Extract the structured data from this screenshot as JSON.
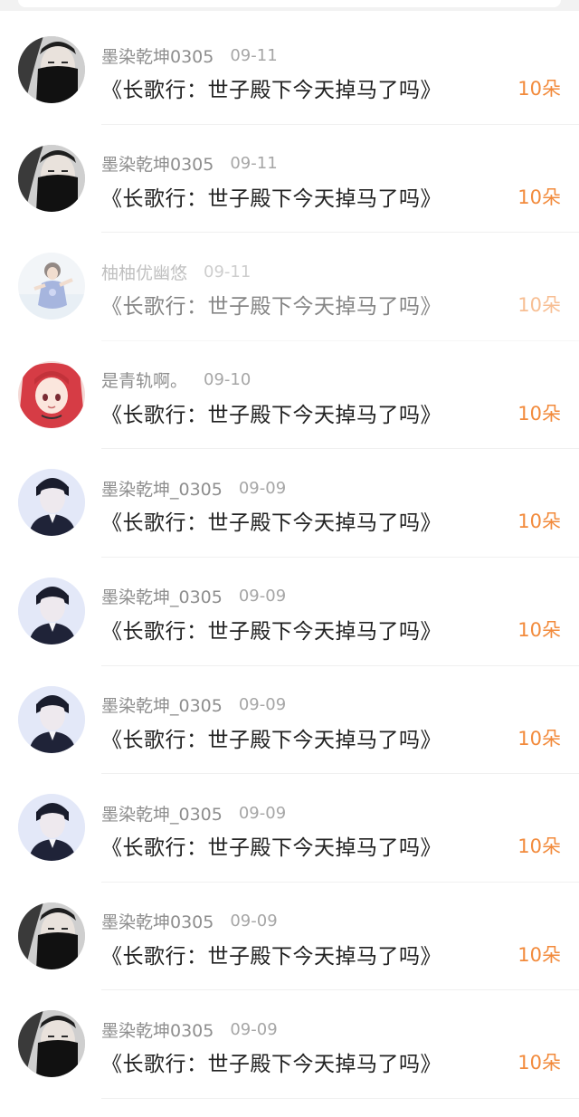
{
  "colors": {
    "accent": "#f28a3b",
    "name_gray": "#8e8e8e",
    "date_gray": "#a6a6a6",
    "title_text": "#222222"
  },
  "rows": [
    {
      "avatar": "masked-man-avatar",
      "name": "墨染乾坤0305",
      "date": "09-11",
      "title": "《长歌行：世子殿下今天掉马了吗》",
      "amount": "10朵"
    },
    {
      "avatar": "masked-man-avatar",
      "name": "墨染乾坤0305",
      "date": "09-11",
      "title": "《长歌行：世子殿下今天掉马了吗》",
      "amount": "10朵"
    },
    {
      "avatar": "skater-avatar",
      "name": "柚柚优幽悠",
      "date": "09-11",
      "title": "《长歌行：世子殿下今天掉马了吗》",
      "amount": "10朵"
    },
    {
      "avatar": "anime-girl-avatar",
      "name": "是青轨啊。",
      "date": "09-10",
      "title": "《长歌行：世子殿下今天掉马了吗》",
      "amount": "10朵"
    },
    {
      "avatar": "suit-man-avatar",
      "name": "墨染乾坤_0305",
      "date": "09-09",
      "title": "《长歌行：世子殿下今天掉马了吗》",
      "amount": "10朵"
    },
    {
      "avatar": "suit-man-avatar",
      "name": "墨染乾坤_0305",
      "date": "09-09",
      "title": "《长歌行：世子殿下今天掉马了吗》",
      "amount": "10朵"
    },
    {
      "avatar": "suit-man-avatar",
      "name": "墨染乾坤_0305",
      "date": "09-09",
      "title": "《长歌行：世子殿下今天掉马了吗》",
      "amount": "10朵"
    },
    {
      "avatar": "suit-man-avatar",
      "name": "墨染乾坤_0305",
      "date": "09-09",
      "title": "《长歌行：世子殿下今天掉马了吗》",
      "amount": "10朵"
    },
    {
      "avatar": "masked-man-avatar",
      "name": "墨染乾坤0305",
      "date": "09-09",
      "title": "《长歌行：世子殿下今天掉马了吗》",
      "amount": "10朵"
    },
    {
      "avatar": "masked-man-avatar",
      "name": "墨染乾坤0305",
      "date": "09-09",
      "title": "《长歌行：世子殿下今天掉马了吗》",
      "amount": "10朵"
    }
  ]
}
